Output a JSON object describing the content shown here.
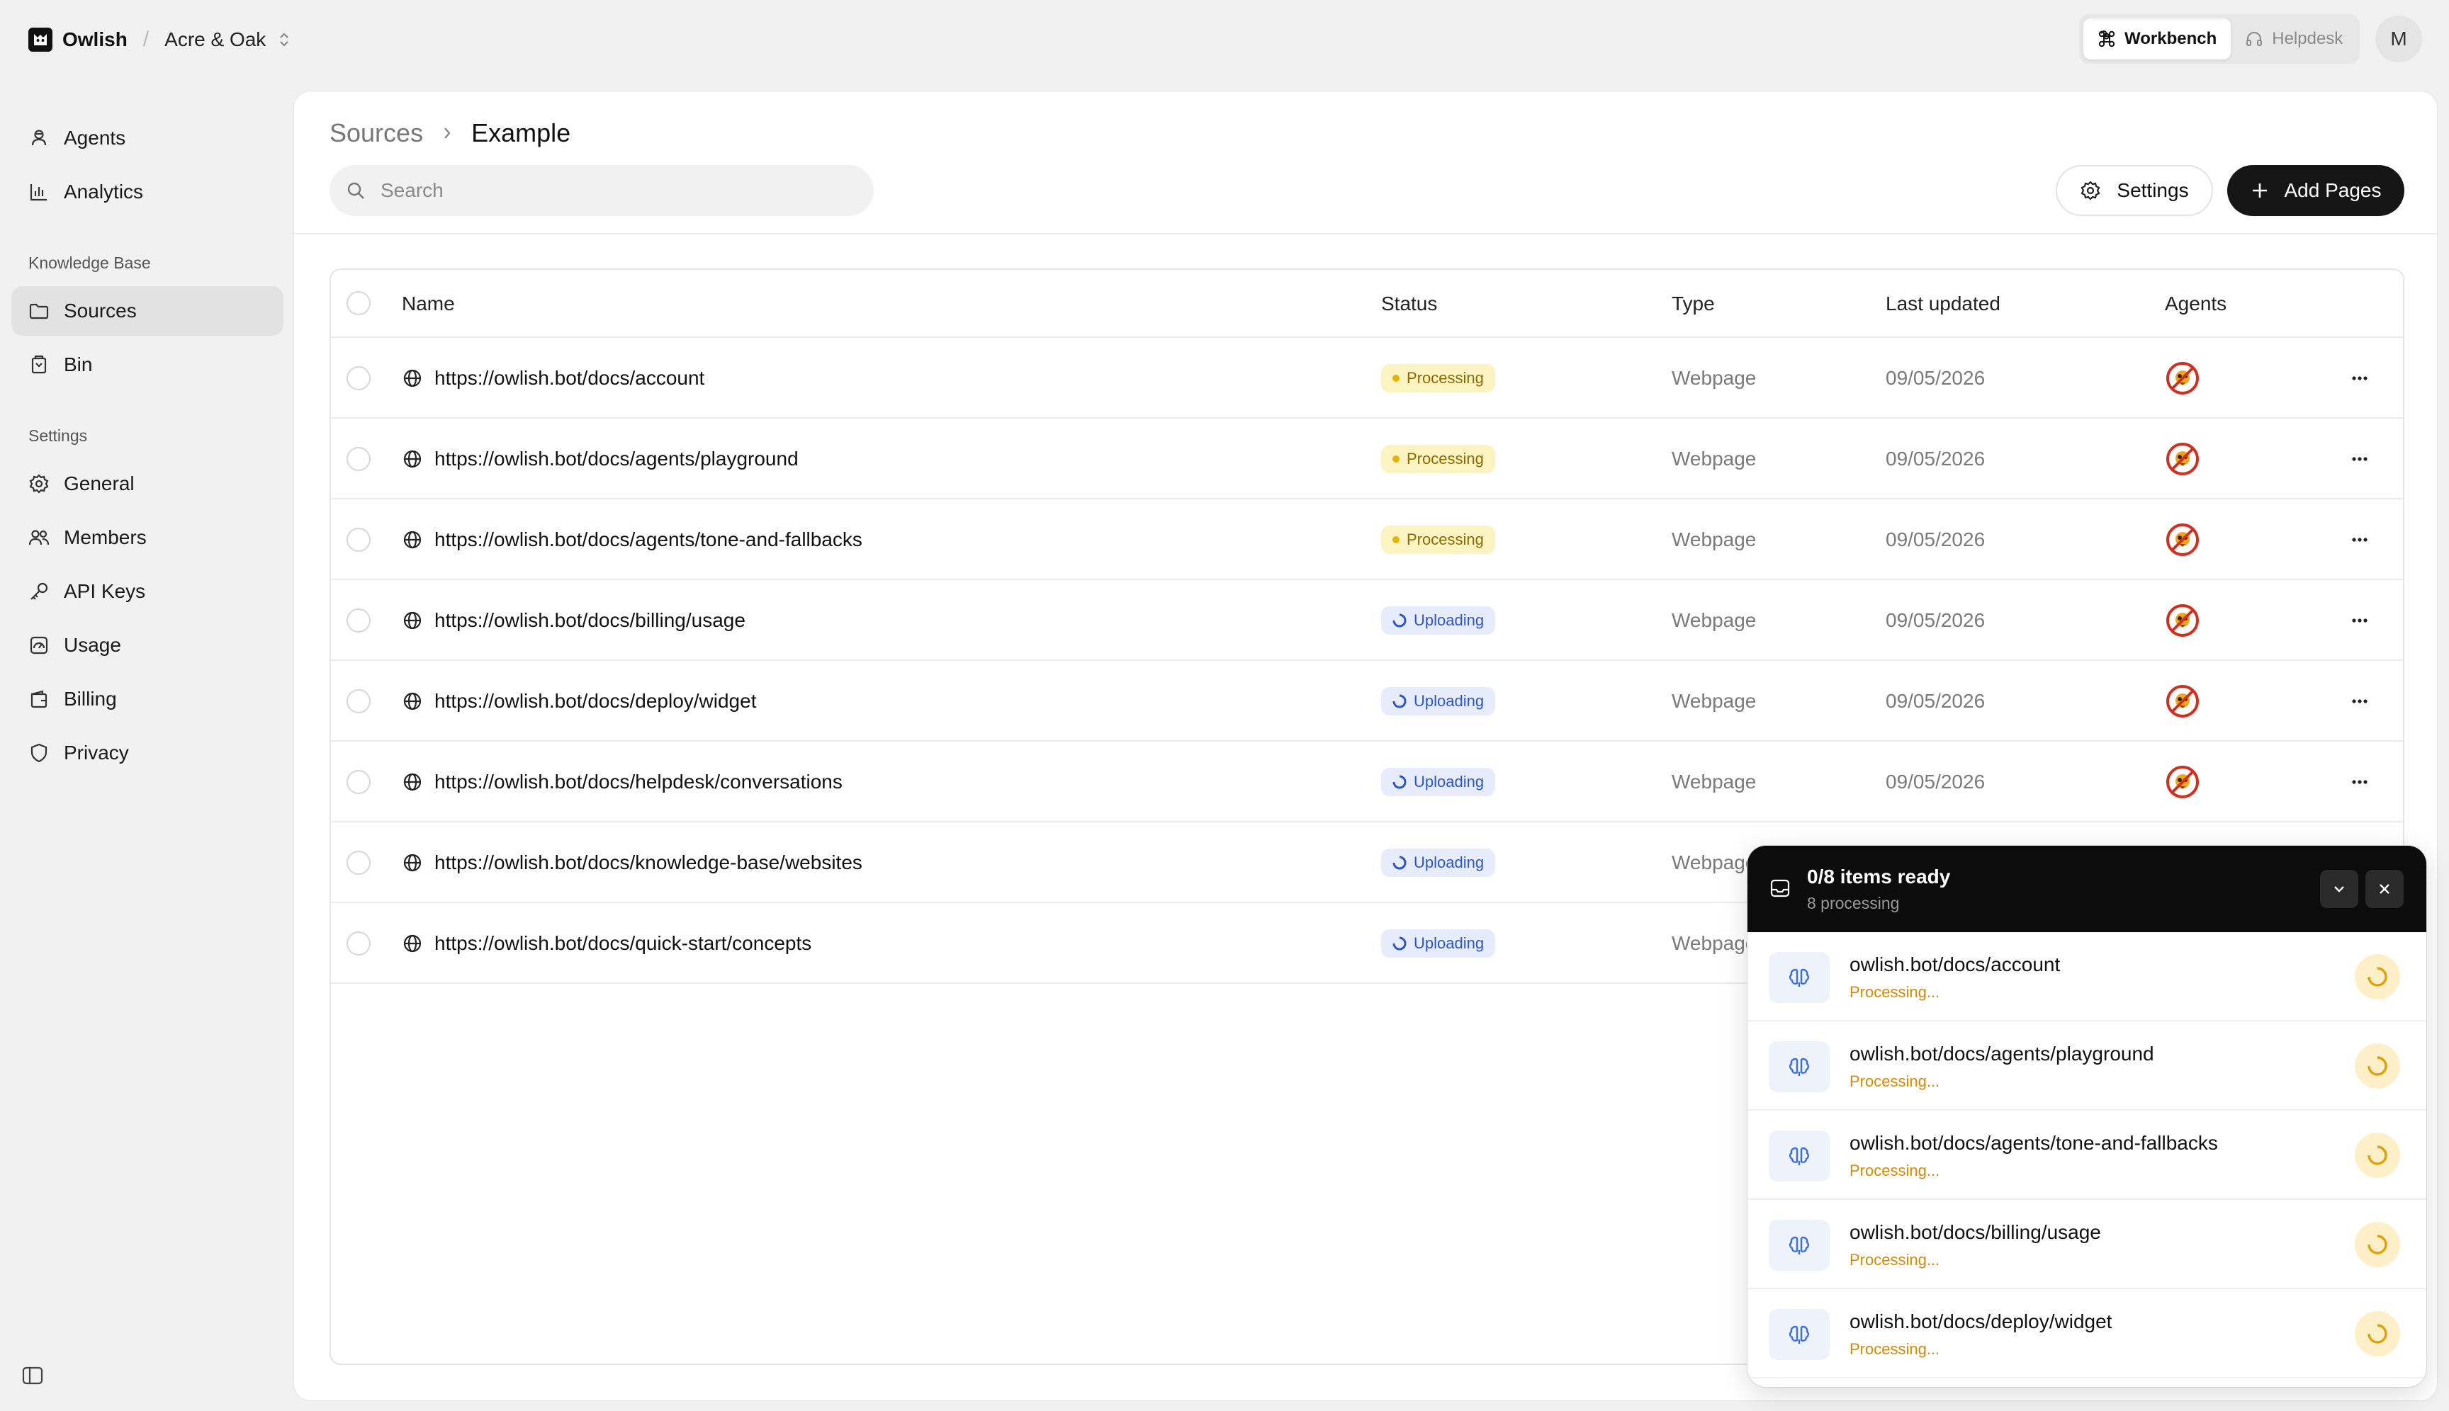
{
  "app": {
    "brand": "Owlish",
    "separator": "/",
    "org": "Acre & Oak",
    "modes": [
      {
        "label": "Workbench",
        "active": true,
        "icon": "command-icon"
      },
      {
        "label": "Helpdesk",
        "active": false,
        "icon": "headset-icon"
      }
    ],
    "avatar_initial": "M"
  },
  "sidebar": {
    "top_items": [
      {
        "label": "Agents",
        "icon": "agent-icon"
      },
      {
        "label": "Analytics",
        "icon": "bar-chart-icon"
      }
    ],
    "knowledge_base": {
      "title": "Knowledge Base",
      "items": [
        {
          "label": "Sources",
          "icon": "folder-icon",
          "active": true
        },
        {
          "label": "Bin",
          "icon": "trash-icon"
        }
      ]
    },
    "settings": {
      "title": "Settings",
      "items": [
        {
          "label": "General",
          "icon": "gear-icon"
        },
        {
          "label": "Members",
          "icon": "users-icon"
        },
        {
          "label": "API Keys",
          "icon": "key-icon"
        },
        {
          "label": "Usage",
          "icon": "gauge-icon"
        },
        {
          "label": "Billing",
          "icon": "wallet-icon"
        },
        {
          "label": "Privacy",
          "icon": "shield-icon"
        }
      ]
    }
  },
  "page": {
    "breadcrumb_root": "Sources",
    "breadcrumb_current": "Example",
    "search_placeholder": "Search",
    "settings_label": "Settings",
    "add_label": "Add Pages"
  },
  "table": {
    "columns": {
      "name": "Name",
      "status": "Status",
      "type": "Type",
      "updated": "Last updated",
      "agents": "Agents"
    },
    "rows": [
      {
        "name": "https://owlish.bot/docs/account",
        "status": "Processing",
        "type": "Webpage",
        "updated": "09/05/2026"
      },
      {
        "name": "https://owlish.bot/docs/agents/playground",
        "status": "Processing",
        "type": "Webpage",
        "updated": "09/05/2026"
      },
      {
        "name": "https://owlish.bot/docs/agents/tone-and-fallbacks",
        "status": "Processing",
        "type": "Webpage",
        "updated": "09/05/2026"
      },
      {
        "name": "https://owlish.bot/docs/billing/usage",
        "status": "Uploading",
        "type": "Webpage",
        "updated": "09/05/2026"
      },
      {
        "name": "https://owlish.bot/docs/deploy/widget",
        "status": "Uploading",
        "type": "Webpage",
        "updated": "09/05/2026"
      },
      {
        "name": "https://owlish.bot/docs/helpdesk/conversations",
        "status": "Uploading",
        "type": "Webpage",
        "updated": "09/05/2026"
      },
      {
        "name": "https://owlish.bot/docs/knowledge-base/websites",
        "status": "Uploading",
        "type": "Webpage",
        "updated": ""
      },
      {
        "name": "https://owlish.bot/docs/quick-start/concepts",
        "status": "Uploading",
        "type": "Webpage",
        "updated": ""
      }
    ]
  },
  "upload_panel": {
    "title": "0/8 items ready",
    "subtitle": "8 processing",
    "items": [
      {
        "name": "owlish.bot/docs/account",
        "state": "Processing..."
      },
      {
        "name": "owlish.bot/docs/agents/playground",
        "state": "Processing..."
      },
      {
        "name": "owlish.bot/docs/agents/tone-and-fallbacks",
        "state": "Processing..."
      },
      {
        "name": "owlish.bot/docs/billing/usage",
        "state": "Processing..."
      },
      {
        "name": "owlish.bot/docs/deploy/widget",
        "state": "Processing..."
      }
    ]
  },
  "colors": {
    "accent": "#161616",
    "processing_bg": "#fbf3c2",
    "processing_text": "#8a6a00",
    "uploading_bg": "#e6ecfb",
    "uploading_text": "#2d55c7",
    "agent_ring": "#d0301f"
  }
}
